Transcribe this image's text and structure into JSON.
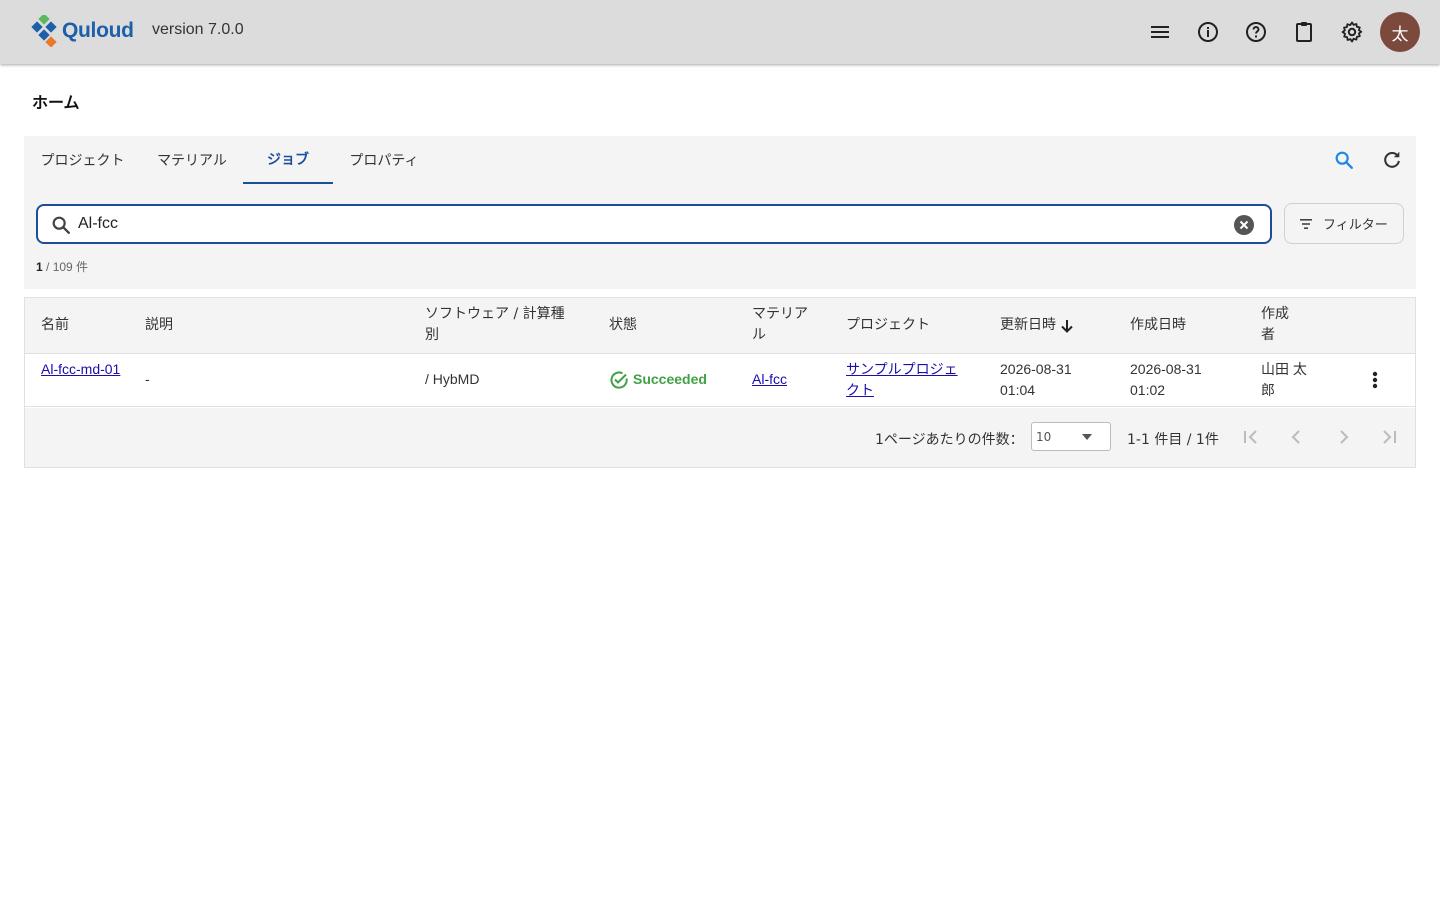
{
  "header": {
    "logo_text": "Quloud",
    "version": "version 7.0.0",
    "avatar_initial": "太",
    "icons": [
      "menu-icon",
      "info-icon",
      "help-icon",
      "clipboard-icon",
      "gear-icon"
    ]
  },
  "page_title": "ホーム",
  "tabs": [
    {
      "label": "プロジェクト",
      "active": false
    },
    {
      "label": "マテリアル",
      "active": false
    },
    {
      "label": "ジョブ",
      "active": true
    },
    {
      "label": "プロパティ",
      "active": false
    }
  ],
  "search": {
    "value": "Al-fcc",
    "placeholder": ""
  },
  "filter_label": "フィルター",
  "result_count": {
    "shown": "1",
    "rest": " / 109 件"
  },
  "table": {
    "columns": [
      "名前",
      "説明",
      "ソフトウェア / 計算種別",
      "状態",
      "マテリアル",
      "プロジェクト",
      "更新日時",
      "作成日時",
      "作成者"
    ],
    "rows": [
      {
        "name": "Al-fcc-md-01",
        "description": "-",
        "software": "/ HybMD",
        "status": "Succeeded",
        "material": "Al-fcc",
        "project": "サンプルプロジェクト",
        "updated": "2026-08-31 01:04",
        "created": "2026-08-31 01:02",
        "author": "山田 太郎"
      }
    ]
  },
  "pagination": {
    "per_page_label": "1ページあたりの件数：",
    "per_page_value": "10",
    "range_label": "1-1 件目 / 1件"
  },
  "colors": {
    "accent": "#1d4e95",
    "success": "#43a047",
    "header_bg": "#dcdcdc",
    "avatar_bg": "#7b4a3d"
  }
}
